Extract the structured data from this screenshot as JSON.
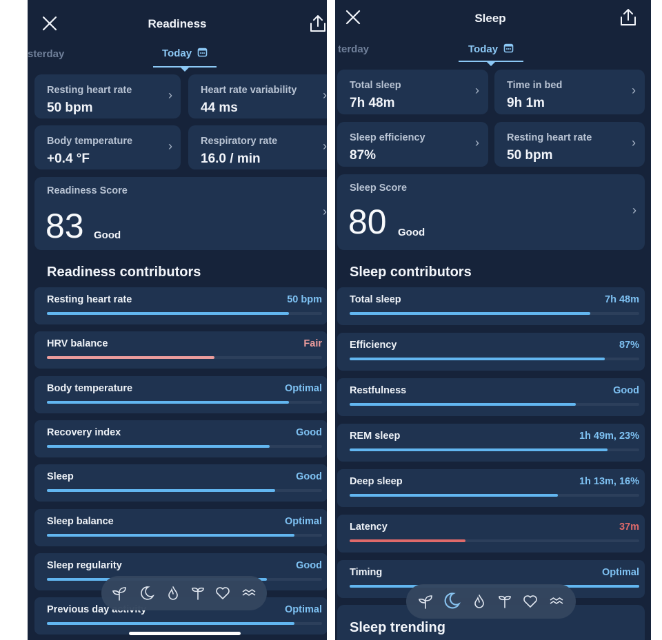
{
  "left": {
    "header": {
      "title": "Readiness",
      "close_icon": "close-icon",
      "share_icon": "share-icon"
    },
    "tabs": {
      "prev": "sterday",
      "active": "Today",
      "calendar_icon": "calendar-icon"
    },
    "metrics": [
      {
        "label": "Resting heart rate",
        "value": "50 bpm"
      },
      {
        "label": "Heart rate variability",
        "value": "44 ms"
      },
      {
        "label": "Body temperature",
        "value": "+0.4 °F"
      },
      {
        "label": "Respiratory rate",
        "value": "16.0 / min"
      }
    ],
    "score": {
      "label": "Readiness Score",
      "value": "83",
      "rating": "Good"
    },
    "contributors_title": "Readiness contributors",
    "contributors": [
      {
        "name": "Resting heart rate",
        "status": "50 bpm",
        "level": 0.88,
        "color": "#62b6f0"
      },
      {
        "name": "HRV balance",
        "status": "Fair",
        "level": 0.61,
        "color": "#eb9c9c"
      },
      {
        "name": "Body temperature",
        "status": "Optimal",
        "level": 0.88,
        "color": "#62b6f0"
      },
      {
        "name": "Recovery index",
        "status": "Good",
        "level": 0.81,
        "color": "#62b6f0"
      },
      {
        "name": "Sleep",
        "status": "Good",
        "level": 0.83,
        "color": "#62b6f0"
      },
      {
        "name": "Sleep balance",
        "status": "Optimal",
        "level": 0.9,
        "color": "#62b6f0"
      },
      {
        "name": "Sleep regularity",
        "status": "Good",
        "level": 0.8,
        "color": "#62b6f0"
      },
      {
        "name": "Previous day activity",
        "status": "Optimal",
        "level": 0.9,
        "color": "#62b6f0"
      }
    ]
  },
  "right": {
    "header": {
      "title": "Sleep",
      "close_icon": "close-icon",
      "share_icon": "share-icon"
    },
    "tabs": {
      "prev": "terday",
      "active": "Today",
      "calendar_icon": "calendar-icon"
    },
    "metrics": [
      {
        "label": "Total sleep",
        "value": "7h 48m"
      },
      {
        "label": "Time in bed",
        "value": "9h 1m"
      },
      {
        "label": "Sleep efficiency",
        "value": "87%"
      },
      {
        "label": "Resting heart rate",
        "value": "50 bpm"
      }
    ],
    "score": {
      "label": "Sleep Score",
      "value": "80",
      "rating": "Good"
    },
    "contributors_title": "Sleep contributors",
    "contributors": [
      {
        "name": "Total sleep",
        "status": "7h 48m",
        "level": 0.83,
        "color": "#62b6f0"
      },
      {
        "name": "Efficiency",
        "status": "87%",
        "level": 0.88,
        "color": "#62b6f0"
      },
      {
        "name": "Restfulness",
        "status": "Good",
        "level": 0.78,
        "color": "#62b6f0"
      },
      {
        "name": "REM sleep",
        "status": "1h 49m, 23%",
        "level": 0.89,
        "color": "#62b6f0"
      },
      {
        "name": "Deep sleep",
        "status": "1h 13m, 16%",
        "level": 0.72,
        "color": "#62b6f0"
      },
      {
        "name": "Latency",
        "status": "37m",
        "level": 0.4,
        "color": "#e06a6a"
      },
      {
        "name": "Timing",
        "status": "Optimal",
        "level": 1.0,
        "color": "#62b6f0"
      }
    ],
    "trending_title": "Sleep trending"
  },
  "nav_icons": [
    "sprout-icon",
    "moon-icon",
    "flame-icon",
    "plant-icon",
    "heart-icon",
    "waves-icon"
  ],
  "colors": {
    "background": "#16233a",
    "card": "#1f3350",
    "accent": "#8cc8f5",
    "bar": "#62b6f0",
    "warn": "#eb9c9c",
    "alert": "#e06a6a"
  }
}
